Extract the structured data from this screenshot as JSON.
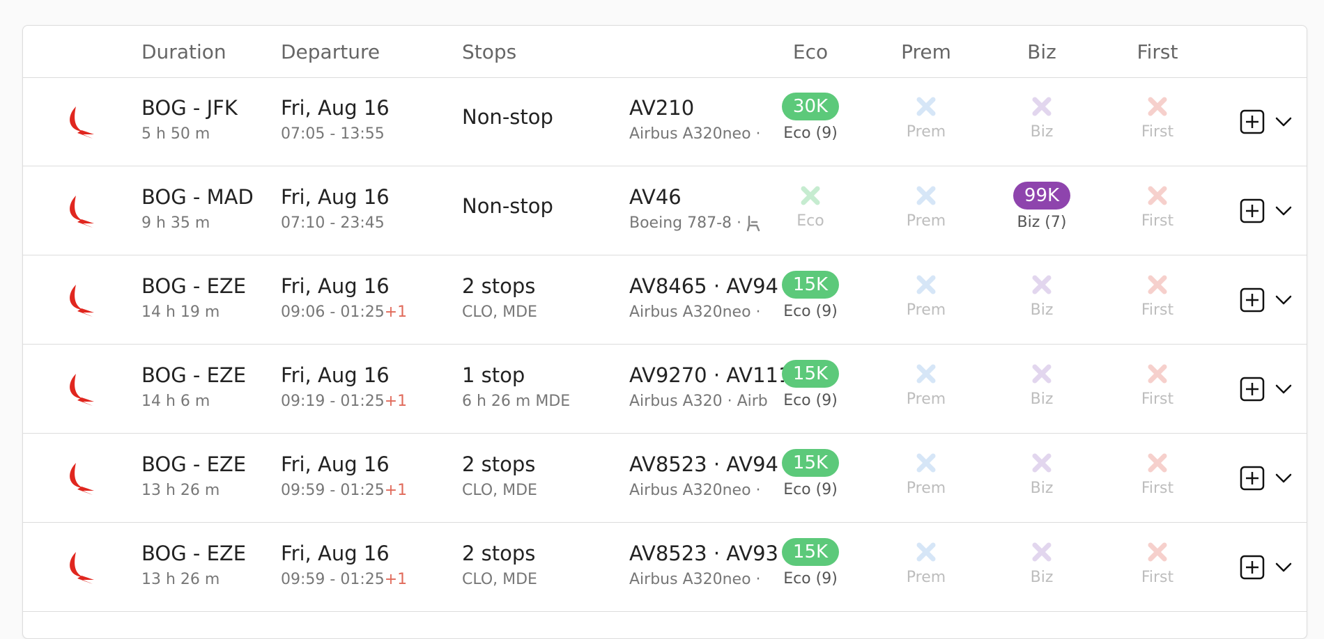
{
  "colors": {
    "eco_badge": "#5cc97a",
    "biz_badge": "#8e44ad",
    "eco_x": "#c6ecd0",
    "prem_x": "#d6e6f7",
    "biz_x": "#e2d6ee",
    "first_x": "#f6d0cc",
    "logo_red": "#e0271f"
  },
  "header": {
    "duration": "Duration",
    "departure": "Departure",
    "stops": "Stops",
    "eco": "Eco",
    "prem": "Prem",
    "biz": "Biz",
    "first": "First"
  },
  "rows": [
    {
      "route": "BOG - JFK",
      "duration": "5 h 50 m",
      "date": "Fri, Aug 16",
      "times": "07:05 - 13:55",
      "plus_day": "",
      "stops": "Non-stop",
      "stops_detail": "",
      "flights": "AV210",
      "aircraft": "Airbus A320neo  ·",
      "seat_icon": "",
      "eco": {
        "available": true,
        "price": "30K",
        "label": "Eco (9)"
      },
      "prem": {
        "available": false,
        "label": "Prem"
      },
      "biz": {
        "available": false,
        "label": "Biz"
      },
      "first": {
        "available": false,
        "label": "First"
      }
    },
    {
      "route": "BOG - MAD",
      "duration": "9 h 35 m",
      "date": "Fri, Aug 16",
      "times": "07:10 - 23:45",
      "plus_day": "",
      "stops": "Non-stop",
      "stops_detail": "",
      "flights": "AV46",
      "aircraft": "Boeing 787-8  ·",
      "seat_icon": "seat-icon",
      "eco": {
        "available": false,
        "label": "Eco"
      },
      "prem": {
        "available": false,
        "label": "Prem"
      },
      "biz": {
        "available": true,
        "price": "99K",
        "label": "Biz (7)"
      },
      "first": {
        "available": false,
        "label": "First"
      }
    },
    {
      "route": "BOG - EZE",
      "duration": "14 h 19 m",
      "date": "Fri, Aug 16",
      "times": "09:06 - 01:25",
      "plus_day": "+1",
      "stops": "2 stops",
      "stops_detail": "CLO, MDE",
      "flights": "AV8465  ·  AV94",
      "aircraft": "Airbus A320neo  ·",
      "seat_icon": "",
      "eco": {
        "available": true,
        "price": "15K",
        "label": "Eco (9)"
      },
      "prem": {
        "available": false,
        "label": "Prem"
      },
      "biz": {
        "available": false,
        "label": "Biz"
      },
      "first": {
        "available": false,
        "label": "First"
      }
    },
    {
      "route": "BOG - EZE",
      "duration": "14 h 6 m",
      "date": "Fri, Aug 16",
      "times": "09:19 - 01:25",
      "plus_day": "+1",
      "stops": "1 stop",
      "stops_detail": "6 h 26 m  MDE",
      "flights": "AV9270  ·  AV111",
      "aircraft": "Airbus A320  ·  Airb",
      "seat_icon": "",
      "eco": {
        "available": true,
        "price": "15K",
        "label": "Eco (9)"
      },
      "prem": {
        "available": false,
        "label": "Prem"
      },
      "biz": {
        "available": false,
        "label": "Biz"
      },
      "first": {
        "available": false,
        "label": "First"
      }
    },
    {
      "route": "BOG - EZE",
      "duration": "13 h 26 m",
      "date": "Fri, Aug 16",
      "times": "09:59 - 01:25",
      "plus_day": "+1",
      "stops": "2 stops",
      "stops_detail": "CLO, MDE",
      "flights": "AV8523  ·  AV94",
      "aircraft": "Airbus A320neo  ·",
      "seat_icon": "",
      "eco": {
        "available": true,
        "price": "15K",
        "label": "Eco (9)"
      },
      "prem": {
        "available": false,
        "label": "Prem"
      },
      "biz": {
        "available": false,
        "label": "Biz"
      },
      "first": {
        "available": false,
        "label": "First"
      }
    },
    {
      "route": "BOG - EZE",
      "duration": "13 h 26 m",
      "date": "Fri, Aug 16",
      "times": "09:59 - 01:25",
      "plus_day": "+1",
      "stops": "2 stops",
      "stops_detail": "CLO, MDE",
      "flights": "AV8523  ·  AV93",
      "aircraft": "Airbus A320neo  ·",
      "seat_icon": "",
      "eco": {
        "available": true,
        "price": "15K",
        "label": "Eco (9)"
      },
      "prem": {
        "available": false,
        "label": "Prem"
      },
      "biz": {
        "available": false,
        "label": "Biz"
      },
      "first": {
        "available": false,
        "label": "First"
      }
    }
  ]
}
